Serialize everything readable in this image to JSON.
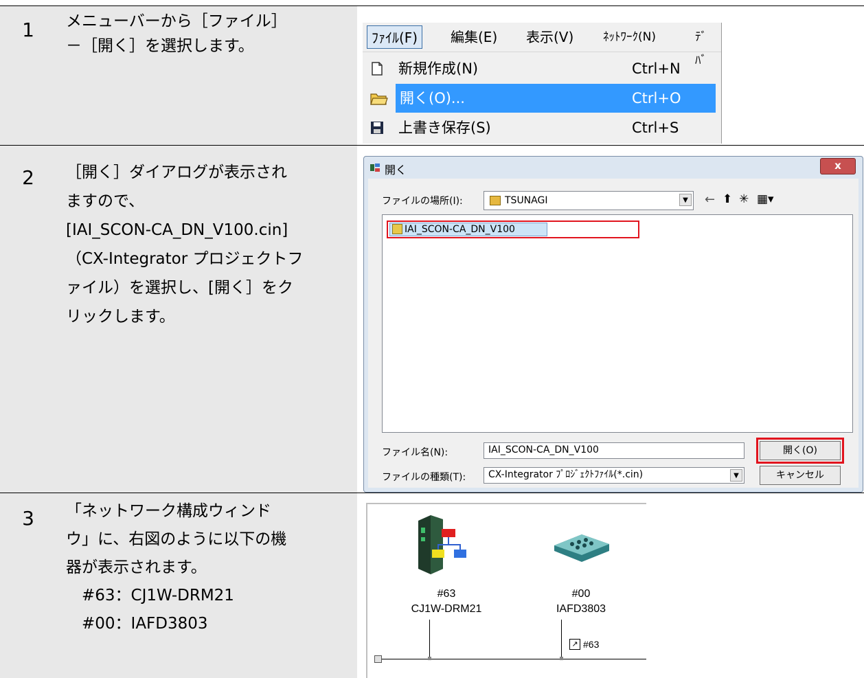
{
  "steps": [
    {
      "number": "1",
      "text": "メニューバーから［ファイル］\n－［開く］を選択します。"
    },
    {
      "number": "2",
      "text": "［開く］ダイアログが表示され\nますので、\n[IAI_SCON-CA_DN_V100.cin]\n（CX-Integrator プロジェクトフ\nァイル）を選択し、[開く］をク\nリックします。"
    },
    {
      "number": "3",
      "text": "「ネットワーク構成ウィンド\nウ」に、右図のように以下の機\n器が表示されます。\n　#63：CJ1W-DRM21\n　#00：IAFD3803"
    }
  ],
  "menu": {
    "bar": [
      "ﾌｧｲﾙ(F)",
      "編集(E)",
      "表示(V)",
      "ﾈｯﾄﾜｰｸ(N)",
      "ﾃﾞﾊﾞ"
    ],
    "items": [
      {
        "label": "新規作成(N)",
        "shortcut": "Ctrl+N",
        "icon": "new-file-icon"
      },
      {
        "label": "開く(O)...",
        "shortcut": "Ctrl+O",
        "icon": "open-folder-icon"
      },
      {
        "label": "上書き保存(S)",
        "shortcut": "Ctrl+S",
        "icon": "save-disk-icon"
      }
    ]
  },
  "dialog": {
    "title": "開く",
    "close": "x",
    "location_label": "ファイルの場所(I):",
    "location_value": "TSUNAGI",
    "file_item": "IAI_SCON-CA_DN_V100",
    "filename_label": "ファイル名(N):",
    "filename_value": "IAI_SCON-CA_DN_V100",
    "filetype_label": "ファイルの種類(T):",
    "filetype_value": "CX-Integrator ﾌﾟﾛｼﾞｪｸﾄﾌｧｲﾙ(*.cin)",
    "open_button": "開く(O)",
    "cancel_button": "キャンセル"
  },
  "network": {
    "devices": [
      {
        "address": "#63",
        "model": "CJ1W-DRM21"
      },
      {
        "address": "#00",
        "model": "IAFD3803"
      }
    ],
    "link_label": "#63"
  },
  "colors": {
    "highlight": "#3399ff",
    "annotation_red": "#e1141e",
    "row_bg": "#e8e8e8"
  }
}
